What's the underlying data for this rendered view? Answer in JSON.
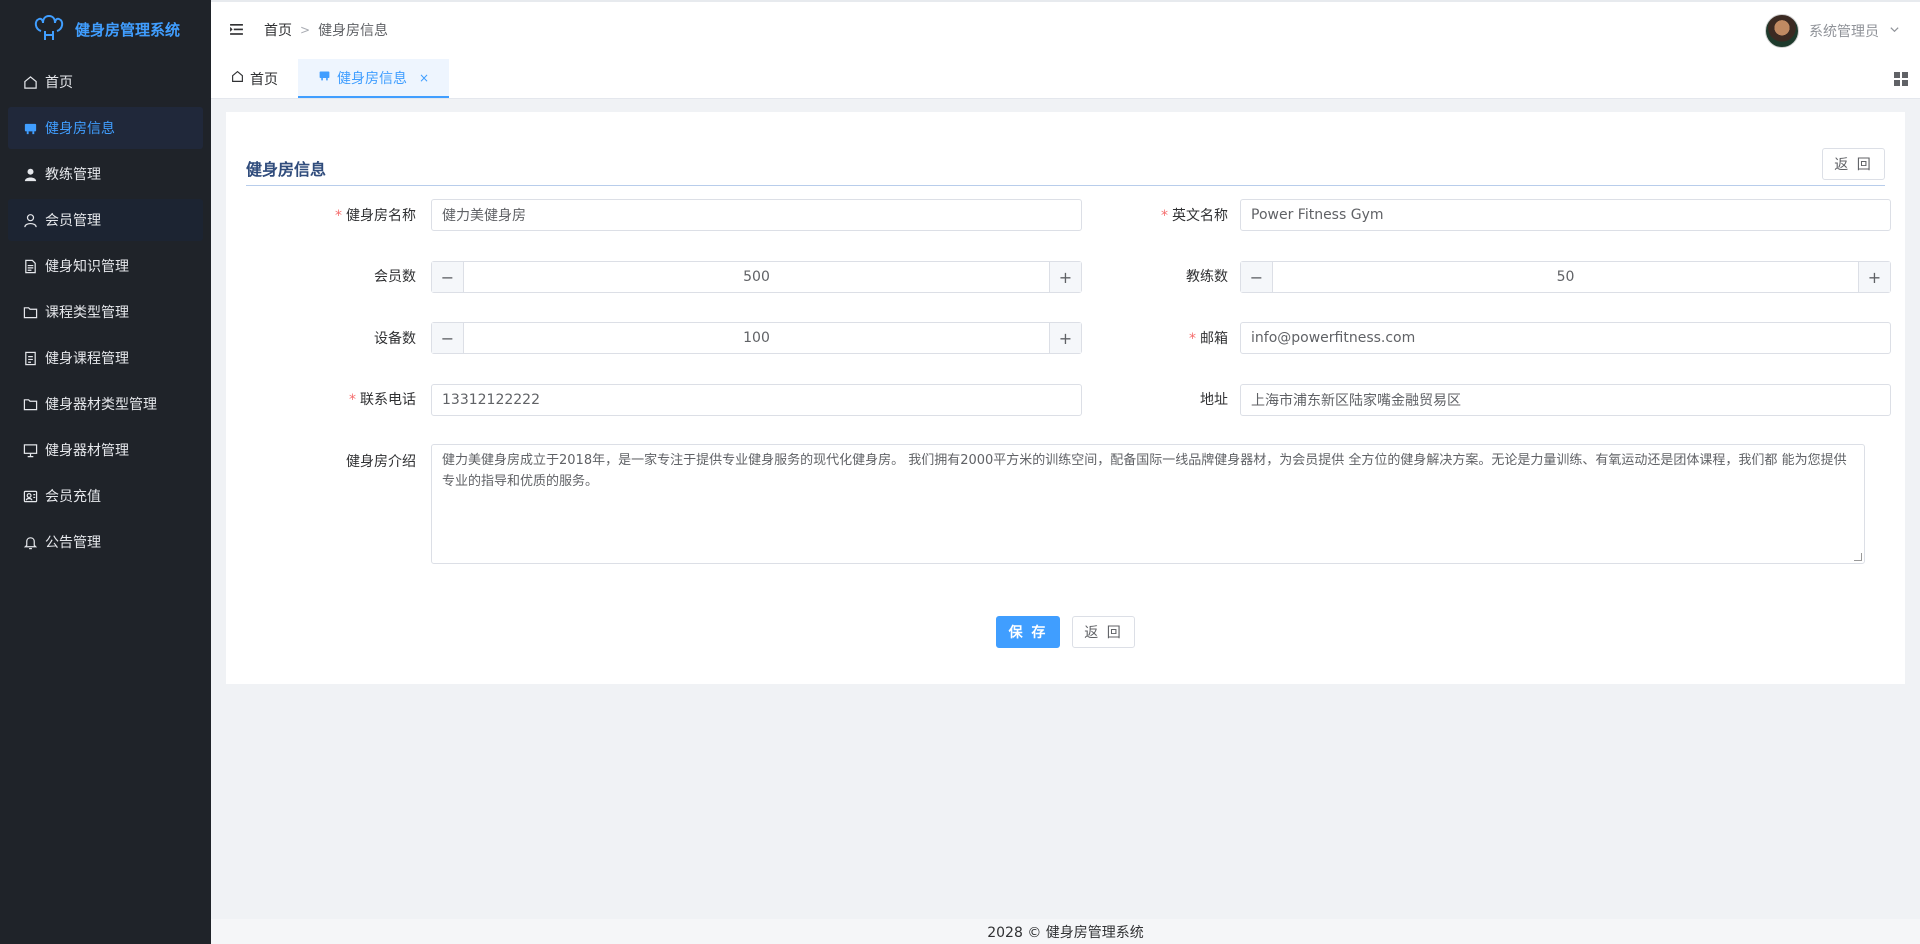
{
  "app": {
    "title": "健身房管理系统"
  },
  "sidebar": {
    "items": [
      {
        "label": "首页",
        "icon": "home-icon"
      },
      {
        "label": "健身房信息",
        "icon": "gym-icon"
      },
      {
        "label": "教练管理",
        "icon": "user-filled-icon"
      },
      {
        "label": "会员管理",
        "icon": "user-icon"
      },
      {
        "label": "健身知识管理",
        "icon": "document-icon"
      },
      {
        "label": "课程类型管理",
        "icon": "folder-icon"
      },
      {
        "label": "健身课程管理",
        "icon": "tickets-icon"
      },
      {
        "label": "健身器材类型管理",
        "icon": "folder-icon"
      },
      {
        "label": "健身器材管理",
        "icon": "monitor-icon"
      },
      {
        "label": "会员充值",
        "icon": "wallet-icon"
      },
      {
        "label": "公告管理",
        "icon": "bell-icon"
      }
    ]
  },
  "header": {
    "breadcrumb": {
      "home": "首页",
      "current": "健身房信息"
    },
    "user": {
      "name": "系统管理员"
    }
  },
  "tabs": [
    {
      "label": "首页"
    },
    {
      "label": "健身房信息",
      "close": "×"
    }
  ],
  "card": {
    "title": "健身房信息",
    "back_label": "返 回"
  },
  "form": {
    "name": {
      "label": "健身房名称",
      "required": "*",
      "value": "健力美健身房"
    },
    "english_name": {
      "label": "英文名称",
      "required": "*",
      "value": "Power Fitness Gym"
    },
    "members": {
      "label": "会员数",
      "value": "500",
      "minus": "−",
      "plus": "+"
    },
    "coaches": {
      "label": "教练数",
      "value": "50",
      "minus": "−",
      "plus": "+"
    },
    "equipment": {
      "label": "设备数",
      "value": "100",
      "minus": "−",
      "plus": "+"
    },
    "email": {
      "label": "邮箱",
      "required": "*",
      "value": "info@powerfitness.com"
    },
    "phone": {
      "label": "联系电话",
      "required": "*",
      "value": "13312122222"
    },
    "address": {
      "label": "地址",
      "value": "上海市浦东新区陆家嘴金融贸易区"
    },
    "intro": {
      "label": "健身房介绍",
      "value": "健力美健身房成立于2018年，是一家专注于提供专业健身服务的现代化健身房。 我们拥有2000平方米的训练空间，配备国际一线品牌健身器材，为会员提供 全方位的健身解决方案。无论是力量训练、有氧运动还是团体课程，我们都 能为您提供专业的指导和优质的服务。"
    }
  },
  "actions": {
    "save_label": "保 存",
    "back_label": "返 回"
  },
  "footer": {
    "text": "2028 © 健身房管理系统"
  },
  "colors": {
    "primary": "#409eff",
    "sidebar": "#1f2329",
    "required": "#f56c6c"
  }
}
